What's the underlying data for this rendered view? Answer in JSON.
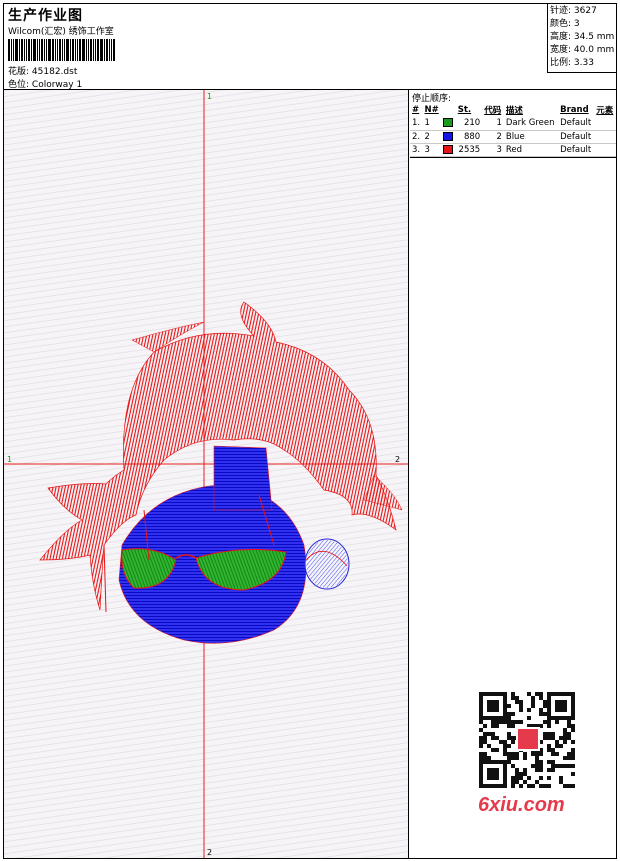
{
  "header": {
    "title": "生产作业图",
    "studio": "Wilcom(汇宏) 绣饰工作室",
    "file_label": "花版:",
    "file_name": "45182.dst",
    "colorway_label": "色位:",
    "colorway": "Colorway 1"
  },
  "stats": {
    "stitches": "针迹: 3627",
    "colors": "颜色: 3",
    "height": "高度: 34.5 mm",
    "width": "宽度: 40.0 mm",
    "scale": "比例: 3.33"
  },
  "canvas": {
    "axis_top": "1",
    "axis_left": "1",
    "axis_right": "2",
    "axis_bottom": "2"
  },
  "stop_sequence": {
    "heading": "停止顺序:",
    "columns": [
      "#",
      "N#",
      "St.",
      "代码",
      "描述",
      "Brand",
      "元素"
    ],
    "rows": [
      {
        "index": "1.",
        "n": "1",
        "color": "#1a9b1a",
        "stitches": "210",
        "code": "1",
        "desc": "Dark Green",
        "brand": "Default",
        "element": ""
      },
      {
        "index": "2.",
        "n": "2",
        "color": "#1414e6",
        "stitches": "880",
        "code": "2",
        "desc": "Blue",
        "brand": "Default",
        "element": ""
      },
      {
        "index": "3.",
        "n": "3",
        "color": "#e61414",
        "stitches": "2535",
        "code": "3",
        "desc": "Red",
        "brand": "Default",
        "element": ""
      }
    ]
  },
  "watermark": "6xiu.com",
  "colors": {
    "red": "#e61414",
    "blue": "#1414e6",
    "green": "#1a9b1a",
    "axis": "#e81e1e"
  }
}
